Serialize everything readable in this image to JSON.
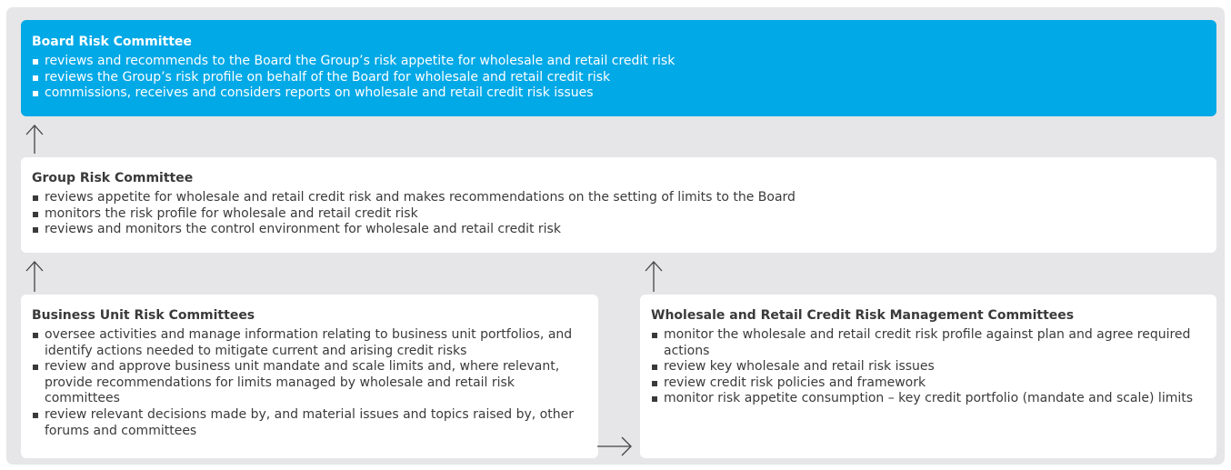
{
  "board": {
    "title": "Board Risk Committee",
    "items": [
      "reviews and recommends to the Board the Group’s risk appetite for wholesale and retail credit risk",
      "reviews the Group’s risk profile on behalf of the Board for wholesale and retail credit risk",
      "commissions, receives and considers reports on wholesale and retail credit risk issues"
    ]
  },
  "group": {
    "title": "Group Risk Committee",
    "items": [
      "reviews appetite for wholesale and retail credit risk and makes recommendations on the setting of limits to the Board",
      "monitors the risk profile for wholesale and retail credit risk",
      "reviews and monitors the control environment for wholesale and retail credit risk"
    ]
  },
  "business_unit": {
    "title": "Business Unit Risk Committees",
    "items": [
      "oversee activities and manage information relating to business unit portfolios, and identify actions needed to mitigate current and arising credit risks",
      "review and approve business unit mandate and scale limits and, where relevant, provide recommendations for limits managed by wholesale and retail risk committees",
      "review relevant decisions made by, and material issues and topics raised by, other forums and committees"
    ]
  },
  "wholesale_retail": {
    "title": "Wholesale and Retail Credit Risk Management Committees",
    "items": [
      "monitor the wholesale and retail credit risk profile against plan and agree required actions",
      "review key wholesale and retail risk issues",
      "review credit risk policies and framework",
      "monitor risk appetite consumption – key credit portfolio (mandate and scale) limits"
    ]
  },
  "colors": {
    "board_fill": "#02a9e7",
    "box_fill": "#ffffff",
    "background": "#e6e6e8",
    "text": "#3a3a3a"
  }
}
